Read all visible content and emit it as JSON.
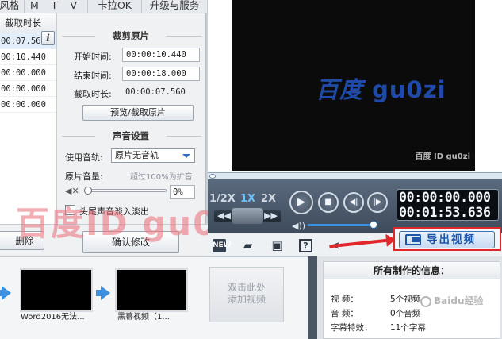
{
  "tabs": [
    {
      "label": "风格"
    },
    {
      "label": "M T V"
    },
    {
      "label": "卡拉OK"
    },
    {
      "label": "升级与服务"
    }
  ],
  "clip_table": {
    "header": "截取时长",
    "rows": [
      "00:07.560",
      "00:10.440",
      "00:00.000",
      "00:00.000",
      "00:00.000"
    ]
  },
  "crop": {
    "title": "裁剪原片",
    "start_label": "开始时间:",
    "start_value": "00:00:10.440",
    "end_label": "结束时间:",
    "end_value": "00:00:18.000",
    "duration_label": "截取时长:",
    "duration_value": "00:00:07.560",
    "preview_button": "预览/截取原片"
  },
  "audio": {
    "title": "声音设置",
    "track_label": "使用音轨:",
    "track_value": "原片无音轨",
    "volume_label": "原片音量:",
    "volume_hint": "超过100%为扩音",
    "volume_value": "0%",
    "volume_level": 0.0,
    "fade_label": "头尾声音淡入淡出"
  },
  "actions": {
    "delete_label": "删除",
    "confirm_label": "确认修改"
  },
  "preview": {
    "watermark_logo_a": "百度",
    "watermark_logo_b": " gu0zi",
    "watermark_small": "百度 ID gu0zi"
  },
  "player": {
    "speeds": [
      "1/2X",
      "1X",
      "2X"
    ],
    "active_speed": "1X",
    "current_time": "00:00:00.000",
    "total_time": "00:01:53.636",
    "volume_level": 0.95
  },
  "export": {
    "label": "导出视频"
  },
  "timeline": {
    "clips": [
      {
        "caption": "Word2016无法..."
      },
      {
        "caption": "黑幕视频（1..."
      }
    ],
    "add_line1": "双击此处",
    "add_line2": "添加视频"
  },
  "info_panel": {
    "title": "所有制作的信息：",
    "rows": [
      {
        "label": "视    频：",
        "value": "5个视频"
      },
      {
        "label": "音    频：",
        "value": "0个音频"
      },
      {
        "label": "字幕特效：",
        "value": "11个字幕"
      }
    ]
  },
  "watermarks": {
    "big": "百度ID gu0zi",
    "baidu_jingyan": "Baidu经验"
  },
  "colors": {
    "accent": "#1c56a8",
    "highlight_red": "#e0272b",
    "active_speed": "#6fc0ff"
  }
}
